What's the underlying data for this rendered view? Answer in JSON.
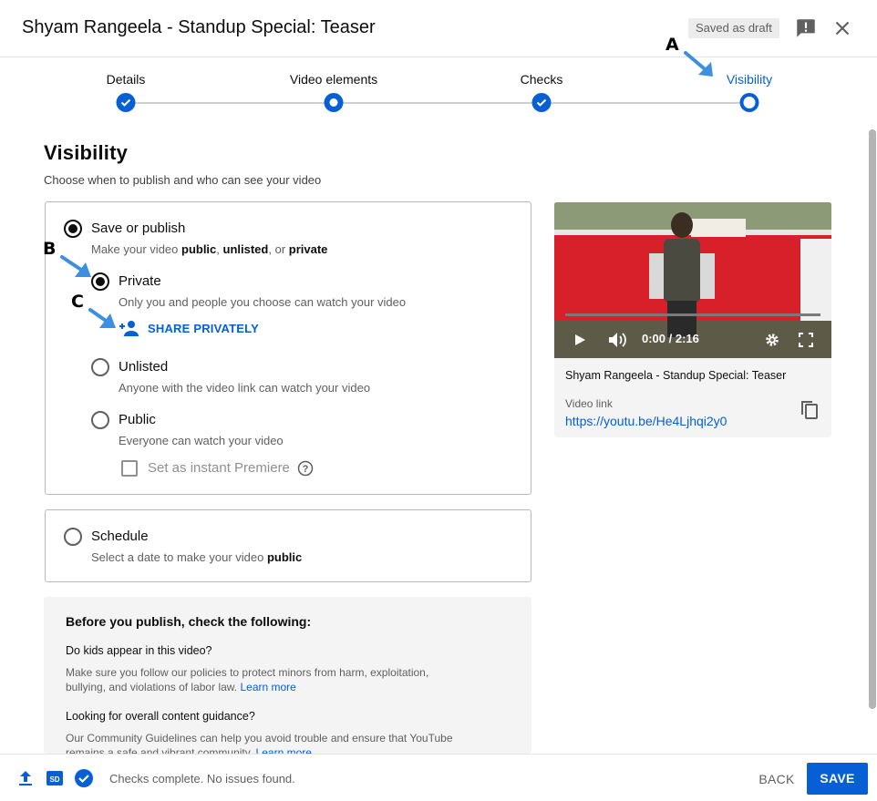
{
  "header": {
    "title": "Shyam Rangeela - Standup Special: Teaser",
    "draft_badge": "Saved as draft",
    "feedback_icon": "feedback-icon",
    "close_icon": "close-icon"
  },
  "stepper": {
    "steps": [
      {
        "label": "Details",
        "state": "done"
      },
      {
        "label": "Video elements",
        "state": "current-ring"
      },
      {
        "label": "Checks",
        "state": "done"
      },
      {
        "label": "Visibility",
        "state": "active"
      }
    ]
  },
  "visibility": {
    "heading": "Visibility",
    "subtitle": "Choose when to publish and who can see your video",
    "save_or_publish": {
      "title": "Save or publish",
      "desc_pre": "Make your video ",
      "desc_public": "public",
      "desc_sep1": ", ",
      "desc_unlisted": "unlisted",
      "desc_sep2": ", or ",
      "desc_private": "private",
      "selected": true
    },
    "options": [
      {
        "title": "Private",
        "desc": "Only you and people you choose can watch your video",
        "selected": true
      },
      {
        "title": "Unlisted",
        "desc": "Anyone with the video link can watch your video",
        "selected": false
      },
      {
        "title": "Public",
        "desc": "Everyone can watch your video",
        "selected": false
      }
    ],
    "share_privately": "SHARE PRIVATELY",
    "instant_premiere": "Set as instant Premiere",
    "schedule": {
      "title": "Schedule",
      "desc_pre": "Select a date to make your video ",
      "desc_bold": "public"
    }
  },
  "checklist": {
    "title": "Before you publish, check the following:",
    "q1": "Do kids appear in this video?",
    "p1": "Make sure you follow our policies to protect minors from harm, exploitation, bullying, and violations of labor law.",
    "q2": "Looking for overall content guidance?",
    "p2": "Our Community Guidelines can help you avoid trouble and ensure that YouTube remains a safe and vibrant community.",
    "learn_more": "Learn more"
  },
  "video": {
    "time": "0:00 / 2:16",
    "title": "Shyam Rangeela - Standup Special: Teaser",
    "link_label": "Video link",
    "link": "https://youtu.be/He4Ljhqi2y0"
  },
  "footer": {
    "status": "Checks complete. No issues found.",
    "back": "BACK",
    "save": "SAVE"
  },
  "annotations": {
    "a": "A",
    "b": "B",
    "c": "C"
  },
  "colors": {
    "accent": "#065fd4",
    "annotation_arrow": "#3d8fe0"
  }
}
